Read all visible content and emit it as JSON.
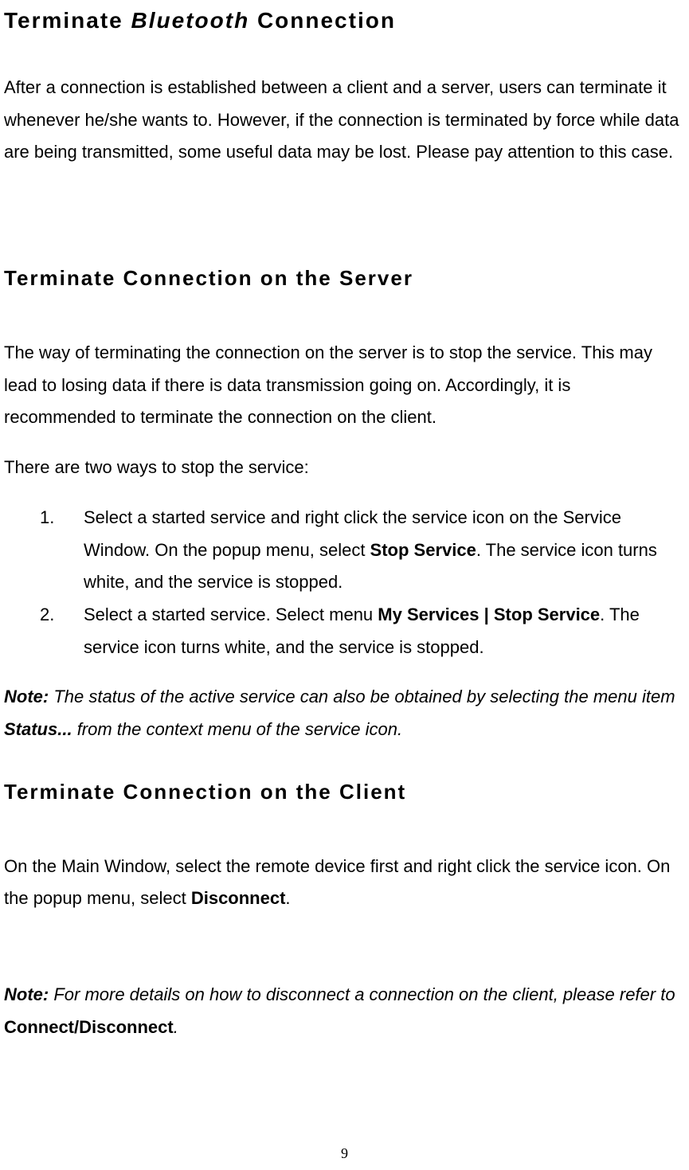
{
  "headings": {
    "h1_part1": "Terminate ",
    "h1_italic": "Bluetooth",
    "h1_part2": " Connection",
    "h2_server": "Terminate Connection on the Server",
    "h2_client": "Terminate Connection on the Client"
  },
  "paragraphs": {
    "intro": "After a connection is established between a client and a server, users can terminate it whenever he/she wants to. However, if the connection is terminated by force while data are being transmitted, some useful data may be lost. Please pay attention to this case.",
    "server_p1": "The way of terminating the connection on the server is to stop the service. This may lead to losing data if there is data transmission going on. Accordingly, it is recommended to terminate the connection on the client.",
    "server_p2": "There are two ways to stop the service:",
    "client_p1_a": "On the Main Window, select the remote device first and right click the service icon. On the popup menu, select ",
    "client_p1_bold": "Disconnect",
    "client_p1_b": "."
  },
  "list": {
    "item1_num": "1.",
    "item1_a": "Select a started service and right click the service icon on the Service Window.   On the popup menu, select ",
    "item1_bold": "Stop Service",
    "item1_b": ". The service icon turns white, and the service is stopped.",
    "item2_num": "2.",
    "item2_a": "Select a started service. Select menu ",
    "item2_bold": "My Services | Stop Service",
    "item2_b": ". The service icon turns white, and the service is stopped."
  },
  "notes": {
    "note1_label": "Note:",
    "note1_a": " The status of the active service can also be obtained by selecting the menu item ",
    "note1_bold": "Status...",
    "note1_b": " from the context menu of the service icon.",
    "note2_label": "Note:",
    "note2_a": " For more details on how to disconnect a connection on the client, please refer to ",
    "note2_bold": "Connect/Disconnect",
    "note2_b": "."
  },
  "page_number": "9"
}
